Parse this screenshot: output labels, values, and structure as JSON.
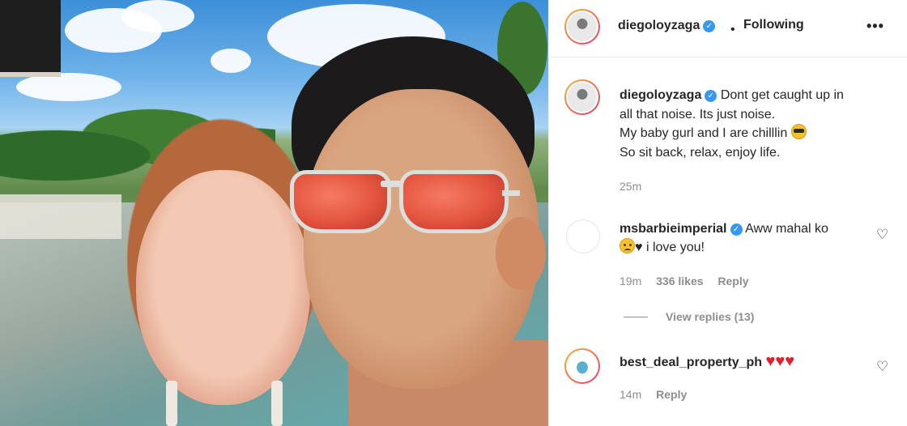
{
  "post": {
    "author": "diegoloyzaga",
    "follow_status": "Following",
    "more_label": "•••",
    "dot": "•",
    "caption_lines": [
      "Dont get caught up in",
      "all that noise. Its just noise.",
      "My baby gurl and I are chilllin",
      "So sit back, relax, enjoy life."
    ],
    "time": "25m"
  },
  "comments": [
    {
      "user": "msbarbieimperial",
      "verified": true,
      "text_line1": "Aww mahal ko",
      "text_line2": "i love you!",
      "time": "19m",
      "likes": "336 likes",
      "reply_label": "Reply",
      "view_replies": "View replies (13)"
    },
    {
      "user": "best_deal_property_ph",
      "verified": false,
      "time": "14m",
      "reply_label": "Reply"
    }
  ],
  "icons": {
    "verified": "verified-badge-icon",
    "more": "more-options-icon",
    "like": "heart-outline-icon",
    "emoji_sunglasses": "sunglasses-emoji-icon",
    "emoji_sad": "pleading-face-emoji-icon",
    "emoji_heart": "black-heart-emoji-icon",
    "red_heart": "red-heart-emoji-icon"
  },
  "colors": {
    "verified_blue": "#3897f0",
    "muted_text": "#8e8e8e",
    "heart_red": "#e2202c"
  }
}
